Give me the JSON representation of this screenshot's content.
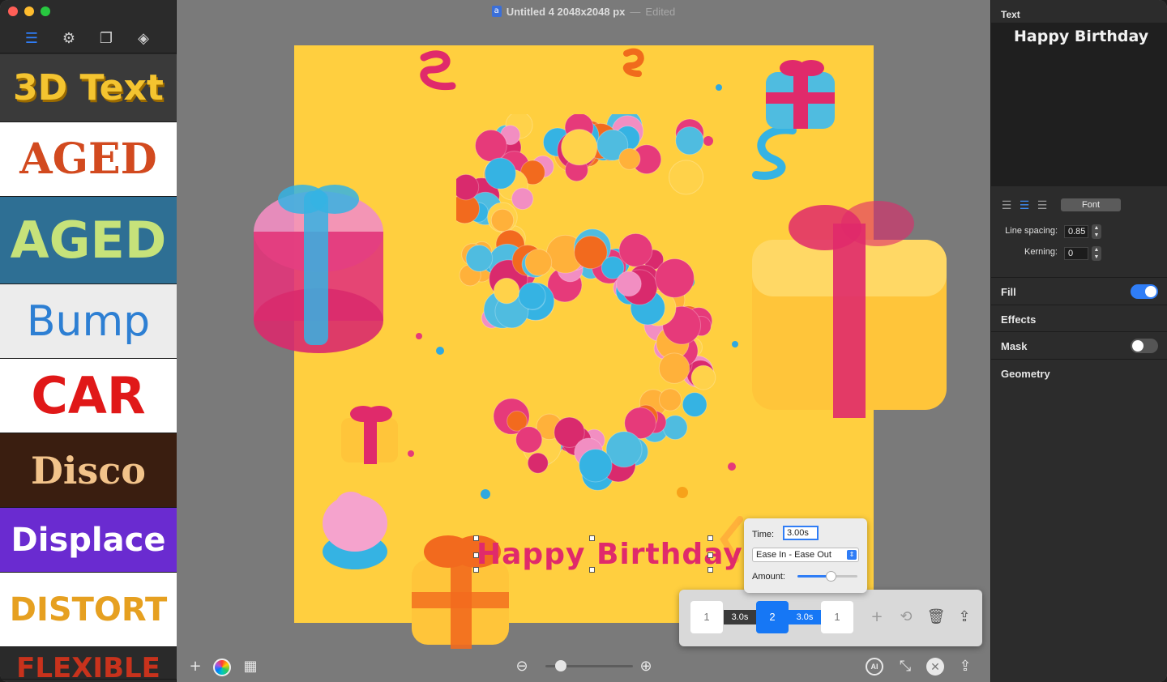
{
  "window": {
    "title": "Untitled 4 2048x2048 px",
    "separator": "—",
    "status": "Edited",
    "app_icon_glyph": "a"
  },
  "sidebar": {
    "toolbar": [
      {
        "name": "list-icon",
        "glyph": "☰",
        "active": true
      },
      {
        "name": "gear-icon",
        "glyph": "⚙",
        "active": false
      },
      {
        "name": "shapes-icon",
        "glyph": "❐",
        "active": false
      },
      {
        "name": "layers-icon",
        "glyph": "◈",
        "active": false
      }
    ],
    "presets": [
      {
        "label": "3D Text",
        "cls": "p-3d"
      },
      {
        "label": "AGED",
        "cls": "p-aged1"
      },
      {
        "label": "AGED",
        "cls": "p-aged2"
      },
      {
        "label": "Bump",
        "cls": "p-bump"
      },
      {
        "label": "CAR",
        "cls": "p-car"
      },
      {
        "label": "Disco",
        "cls": "p-disco"
      },
      {
        "label": "Displace",
        "cls": "p-displace"
      },
      {
        "label": "DISTORT",
        "cls": "p-distort"
      },
      {
        "label": "FLEXIBLE",
        "cls": "p-flexible"
      }
    ]
  },
  "canvas": {
    "artboard_color": "#ffcf3f",
    "numeral": "5",
    "text_layer": "Happy Birthday"
  },
  "timeline": {
    "keyframes": [
      "1",
      "2",
      "1"
    ],
    "durations": [
      "3.0s",
      "3.0s"
    ],
    "active_keyframe": 1,
    "popover": {
      "time_label": "Time:",
      "time_value": "3.00s",
      "easing": "Ease In - Ease Out",
      "amount_label": "Amount:",
      "amount": 0.55
    }
  },
  "bottombar": {
    "add_glyph": "+",
    "zoom": 0.18,
    "ai_label": "AI",
    "close_glyph": "✕"
  },
  "inspector": {
    "header": "Text",
    "text_value": "Happy Birthday",
    "font_button": "Font",
    "line_spacing_label": "Line spacing:",
    "line_spacing_value": "0.85",
    "kerning_label": "Kerning:",
    "kerning_value": "0",
    "sections": [
      {
        "label": "Fill",
        "toggle": "on"
      },
      {
        "label": "Effects",
        "toggle": null
      },
      {
        "label": "Mask",
        "toggle": "off"
      },
      {
        "label": "Geometry",
        "toggle": null
      }
    ]
  },
  "colors": {
    "accent": "#2f7df6",
    "text_pink": "#e02a6b",
    "canvas_bg": "#7a7a7a"
  }
}
